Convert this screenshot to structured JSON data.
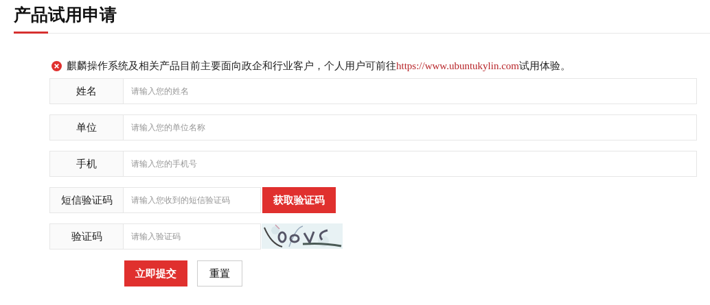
{
  "title": "产品试用申请",
  "notice": {
    "text": "麒麟操作系统及相关产品目前主要面向政企和行业客户，个人用户可前往",
    "link": "https://www.ubuntukylin.com",
    "suffix": "试用体验。"
  },
  "fields": [
    {
      "kind": "text",
      "label": "姓名",
      "placeholder": "请输入您的姓名"
    },
    {
      "kind": "text",
      "label": "单位",
      "placeholder": "请输入您的单位名称"
    },
    {
      "kind": "text",
      "label": "手机",
      "placeholder": "请输入您的手机号"
    },
    {
      "kind": "sms",
      "label": "短信验证码",
      "placeholder": "请输入您收到的短信验证码",
      "button": "获取验证码"
    },
    {
      "kind": "captcha",
      "label": "验证码",
      "placeholder": "请输入验证码"
    }
  ],
  "buttons": {
    "submit": "立即提交",
    "reset": "重置"
  }
}
